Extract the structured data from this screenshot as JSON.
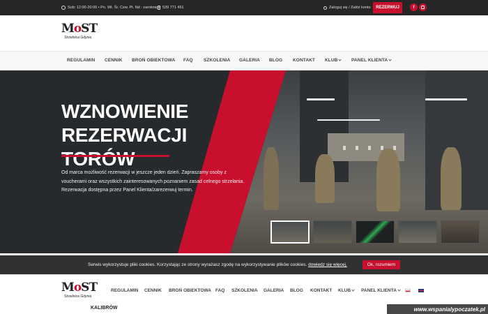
{
  "topbar": {
    "hours": "Sob: 12:00-20:00 • Pn. Wt. Śr. Czw. Pt. Nd : zamknięte",
    "phone": "539 771 451",
    "login": "Zaloguj się / Załóż konto",
    "reserve_label": "REZERWUJ",
    "facebook": "f"
  },
  "logo": {
    "mark_dark": "M",
    "mark_red": "o",
    "mark_tail": "ST",
    "sub": "Strzelnica Gdynia"
  },
  "nav": {
    "items": [
      "REGULAMIN",
      "CENNIK",
      "BROŃ OBIEKTOWA",
      "FAQ",
      "SZKOLENIA",
      "GALERIA",
      "BLOG",
      "KONTAKT",
      "KLUB",
      "PANEL KLIENTA"
    ]
  },
  "hero": {
    "title_line1": "WZNOWIENIE REZERWACJI",
    "title_line2": "TORÓW",
    "body": "Od marca możliwość rezerwacji w jeszcze jeden dzień. Zapraszamy osoby z voucherami oraz wszystkich zainteresowanych poznaniem zasad celnego strzelania. Rezerwacja dostępna przez Panel Klienta/zarezerwuj termin."
  },
  "cookie": {
    "message": "Serwis wykorzystuje pliki cookies. Korzystając ze strony wyrażasz zgodę na wykorzystywanie plików cookies.",
    "link": "dowiedz się więcej.",
    "ok_label": "Ok, rozumiem"
  },
  "sticky": {
    "items": [
      "REGULAMIN",
      "CENNIK",
      "BROŃ OBIEKTOWA",
      "FAQ",
      "SZKOLENIA",
      "GALERIA",
      "BLOG",
      "KONTAKT",
      "KLUB",
      "PANEL KLIENTA"
    ]
  },
  "peek": {
    "kalibrow": "KALIBRÓW"
  },
  "watermark": "www.wspanialypoczatek.pl",
  "colors": {
    "accent": "#c8102e",
    "dark": "#262626"
  }
}
